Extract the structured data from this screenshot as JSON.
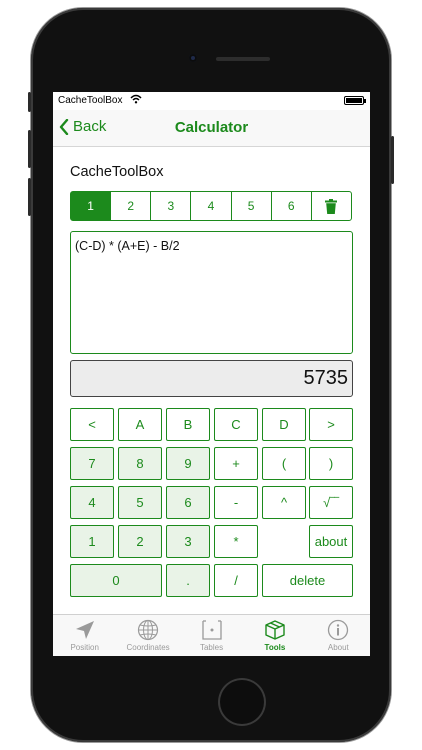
{
  "status_bar": {
    "carrier": "CacheToolBox"
  },
  "navbar": {
    "back_label": "Back",
    "title": "Calculator"
  },
  "app_name": "CacheToolBox",
  "memory_tabs": {
    "items": [
      "1",
      "2",
      "3",
      "4",
      "5",
      "6"
    ],
    "active_index": 0,
    "trash_icon": "trash-icon"
  },
  "formula": "(C-D) * (A+E) - B/2",
  "result": "5735",
  "keypad": {
    "row1": [
      "<",
      "A",
      "B",
      "C",
      "D",
      ">"
    ],
    "row2": [
      "7",
      "8",
      "9",
      "+",
      "(",
      ")"
    ],
    "row3": [
      "4",
      "5",
      "6",
      "-",
      "^",
      "√‾‾"
    ],
    "row4": [
      "1",
      "2",
      "3",
      "*",
      "about"
    ],
    "row5": [
      "0",
      ".",
      "/",
      "delete"
    ]
  },
  "tab_bar": {
    "items": [
      {
        "label": "Position",
        "icon": "location-arrow-icon"
      },
      {
        "label": "Coordinates",
        "icon": "globe-icon"
      },
      {
        "label": "Tables",
        "icon": "table-icon"
      },
      {
        "label": "Tools",
        "icon": "box-icon"
      },
      {
        "label": "About",
        "icon": "info-icon"
      }
    ],
    "active_index": 3
  },
  "colors": {
    "accent": "#1c8a1c",
    "key_fill": "#e9f3e7",
    "result_bg": "#ececec"
  }
}
